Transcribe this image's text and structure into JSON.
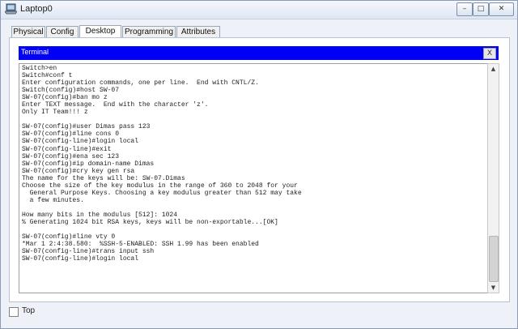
{
  "window": {
    "title": "Laptop0",
    "icon": "laptop-icon",
    "controls": {
      "minimize": "–",
      "maximize": "□",
      "close": "✕"
    }
  },
  "tabs": [
    {
      "label": "Physical",
      "active": false
    },
    {
      "label": "Config",
      "active": false
    },
    {
      "label": "Desktop",
      "active": true
    },
    {
      "label": "Programming",
      "active": false
    },
    {
      "label": "Attributes",
      "active": false
    }
  ],
  "terminal": {
    "title": "Terminal",
    "close_label": "X",
    "lines": [
      "Switch>en",
      "Switch#conf t",
      "Enter configuration commands, one per line.  End with CNTL/Z.",
      "Switch(config)#host SW-07",
      "SW-07(config)#ban mo z",
      "Enter TEXT message.  End with the character 'z'.",
      "Only IT Team!!! z",
      "",
      "SW-07(config)#user Dimas pass 123",
      "SW-07(config)#line cons 0",
      "SW-07(config-line)#login local",
      "SW-07(config-line)#exit",
      "SW-07(config)#ena sec 123",
      "SW-07(config)#ip domain-name Dimas",
      "SW-07(config)#cry key gen rsa",
      "The name for the keys will be: SW-07.Dimas",
      "Choose the size of the key modulus in the range of 360 to 2048 for your",
      "  General Purpose Keys. Choosing a key modulus greater than 512 may take",
      "  a few minutes.",
      "",
      "How many bits in the modulus [512]: 1024",
      "% Generating 1024 bit RSA keys, keys will be non-exportable...[OK]",
      "",
      "SW-07(config)#line vty 0",
      "*Mar 1 2:4:38.580:  %SSH-5-ENABLED: SSH 1.99 has been enabled",
      "SW-07(config-line)#trans input ssh",
      "SW-07(config-line)#login local"
    ]
  },
  "bottom": {
    "top_label": "Top",
    "top_checked": false
  }
}
